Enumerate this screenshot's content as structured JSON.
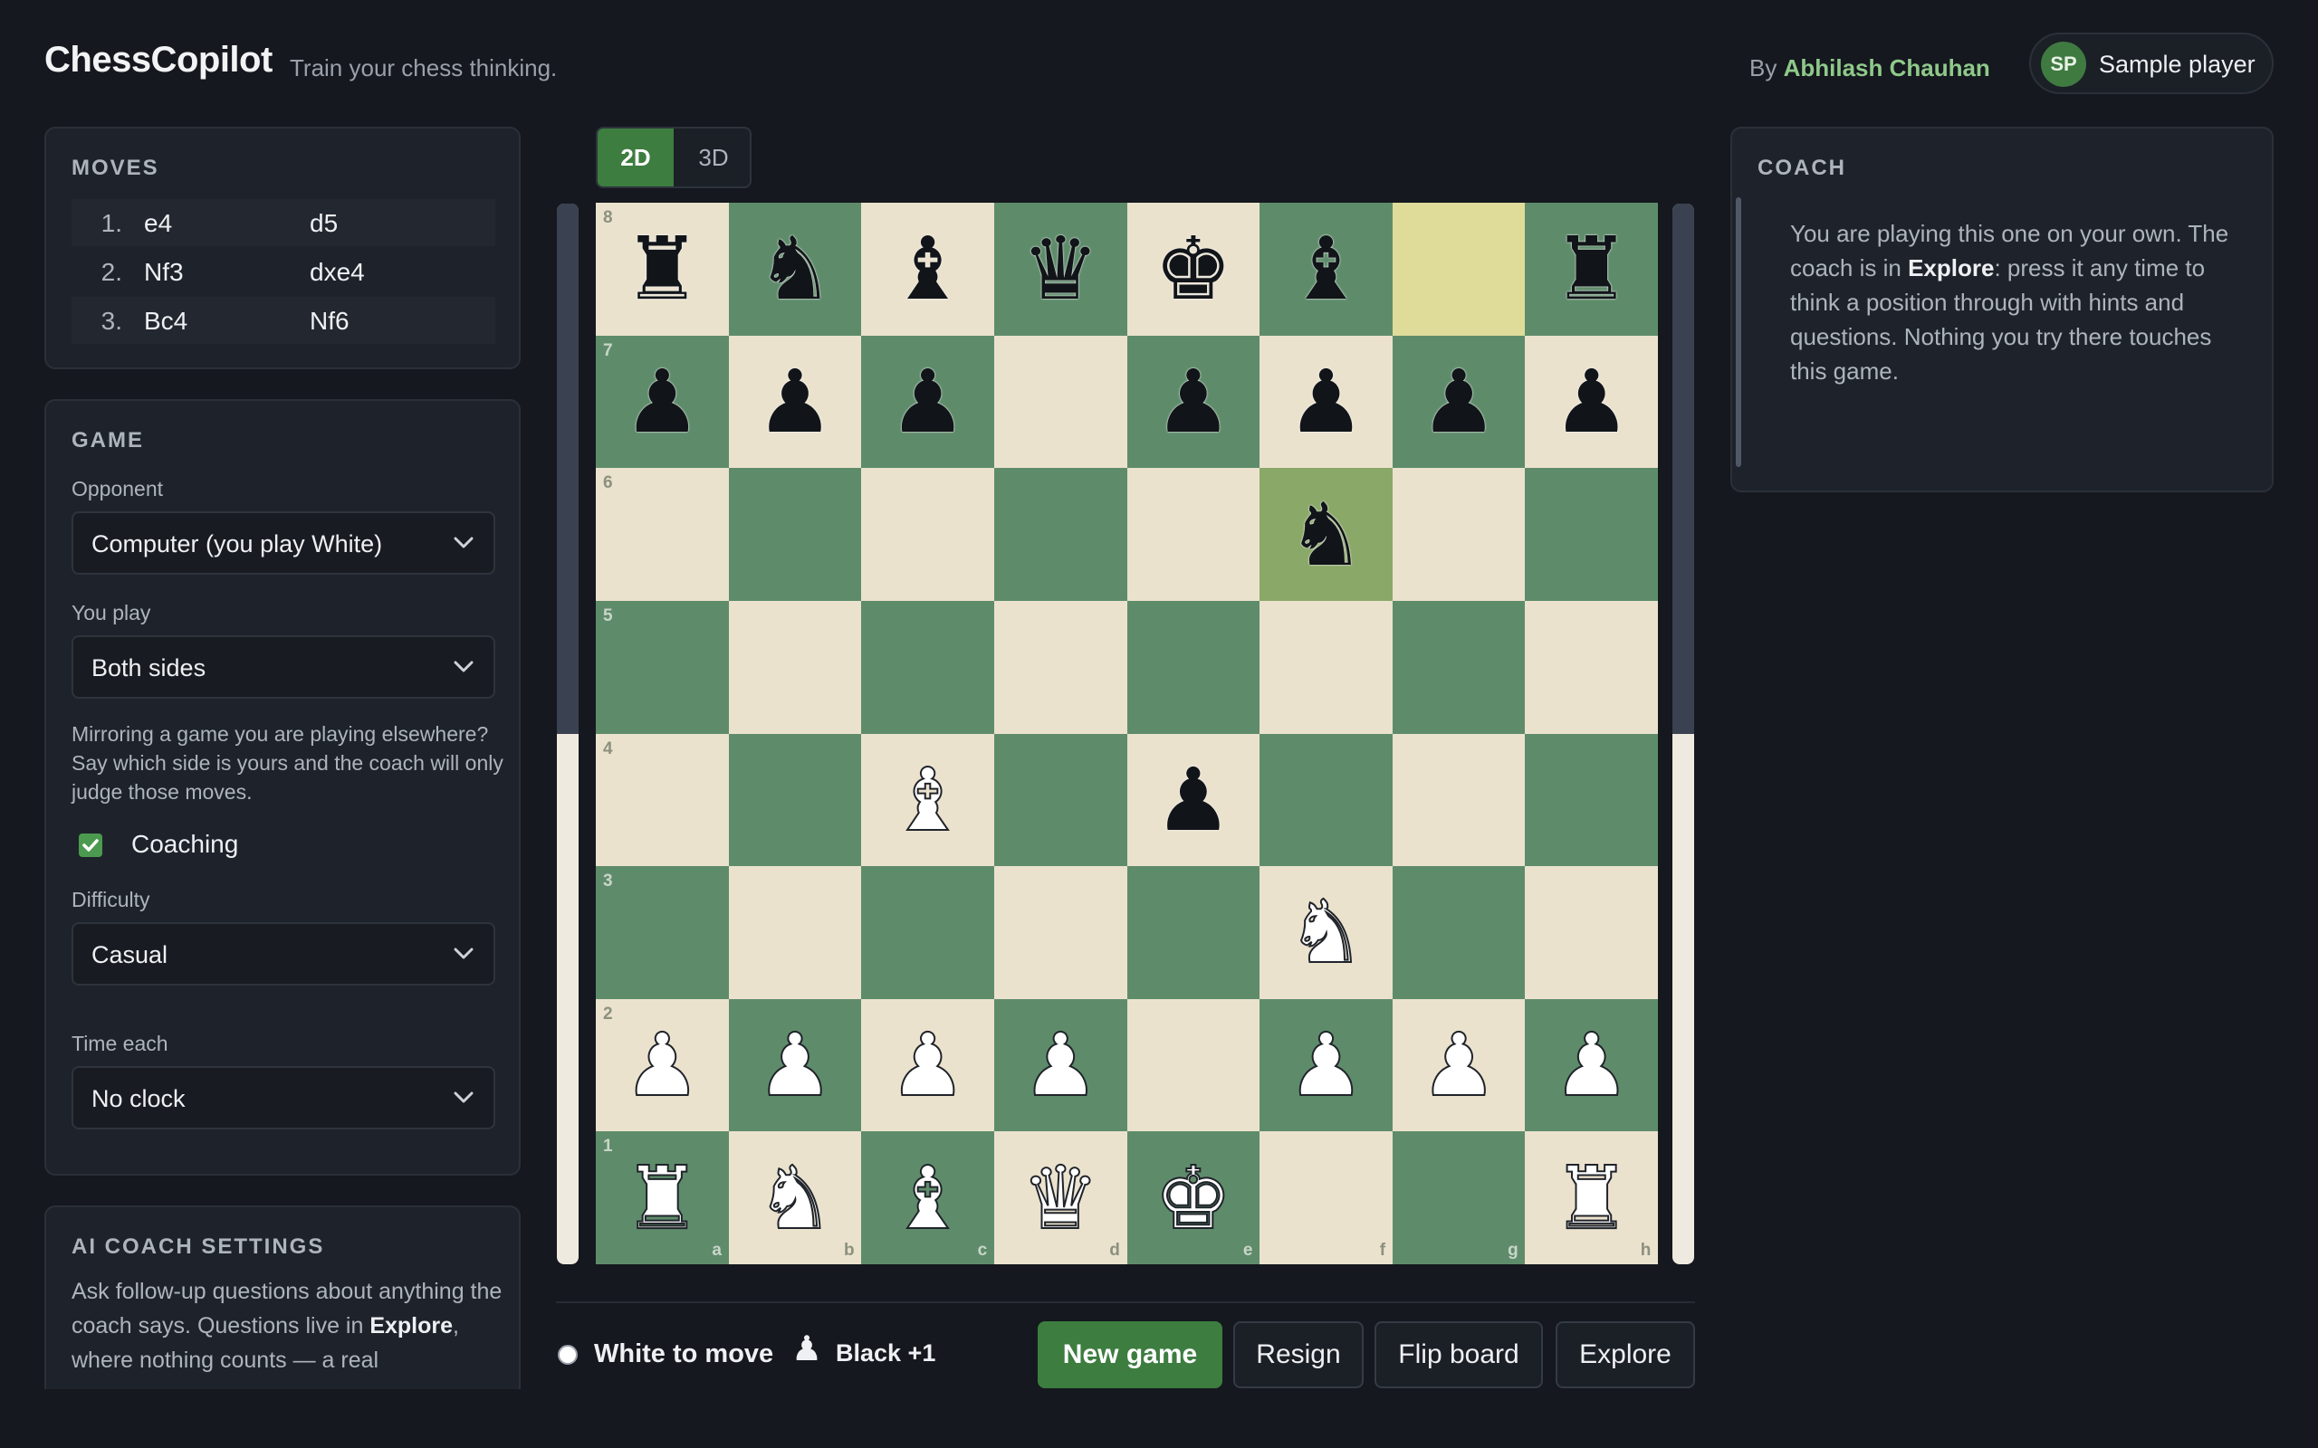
{
  "header": {
    "logo": "ChessCopilot",
    "tagline": "Train your chess thinking.",
    "by_prefix": "By",
    "author": "Abhilash Chauhan",
    "player_initials": "SP",
    "player_name": "Sample player"
  },
  "moves": {
    "title": "MOVES",
    "rows": [
      {
        "num": "1.",
        "white": "e4",
        "black": "d5"
      },
      {
        "num": "2.",
        "white": "Nf3",
        "black": "dxe4"
      },
      {
        "num": "3.",
        "white": "Bc4",
        "black": "Nf6"
      }
    ]
  },
  "game": {
    "title": "GAME",
    "opponent_label": "Opponent",
    "opponent_value": "Computer (you play White)",
    "you_play_label": "You play",
    "you_play_value": "Both sides",
    "help_text": "Mirroring a game you are playing elsewhere? Say which side is yours and the coach will only judge those moves.",
    "coaching_label": "Coaching",
    "coaching_checked": true,
    "difficulty_label": "Difficulty",
    "difficulty_value": "Casual",
    "time_label": "Time each",
    "time_value": "No clock"
  },
  "ai_settings": {
    "title": "AI COACH SETTINGS",
    "text_1": "Ask follow-up questions about anything the coach says. Questions live in ",
    "text_bold": "Explore",
    "text_2": ", where nothing counts — a real"
  },
  "view": {
    "options": [
      "2D",
      "3D"
    ],
    "active": "2D"
  },
  "board": {
    "ranks": [
      "8",
      "7",
      "6",
      "5",
      "4",
      "3",
      "2",
      "1"
    ],
    "files": [
      "a",
      "b",
      "c",
      "d",
      "e",
      "f",
      "g",
      "h"
    ],
    "highlight": [
      "g8",
      "f6"
    ],
    "pieces": {
      "a8": "br",
      "b8": "bn",
      "c8": "bb",
      "d8": "bq",
      "e8": "bk",
      "f8": "bb",
      "h8": "br",
      "a7": "bp",
      "b7": "bp",
      "c7": "bp",
      "e7": "bp",
      "f7": "bp",
      "g7": "bp",
      "h7": "bp",
      "f6": "bn",
      "c4": "wb",
      "e4": "bp",
      "f3": "wn",
      "a2": "wp",
      "b2": "wp",
      "c2": "wp",
      "d2": "wp",
      "f2": "wp",
      "g2": "wp",
      "h2": "wp",
      "a1": "wr",
      "b1": "wn",
      "c1": "wb",
      "d1": "wq",
      "e1": "wk",
      "h1": "wr"
    },
    "eval_black_fraction": 0.5
  },
  "status": {
    "turn": "White to move",
    "material_icon": "pawn-icon",
    "material": "Black +1"
  },
  "actions": {
    "new_game": "New game",
    "resign": "Resign",
    "flip": "Flip board",
    "explore": "Explore"
  },
  "coach": {
    "title": "COACH",
    "text_1": "You are playing this one on your own. The coach is in ",
    "text_bold": "Explore",
    "text_2": ": press it any time to think a position through with hints and questions. Nothing you try there touches this game."
  }
}
